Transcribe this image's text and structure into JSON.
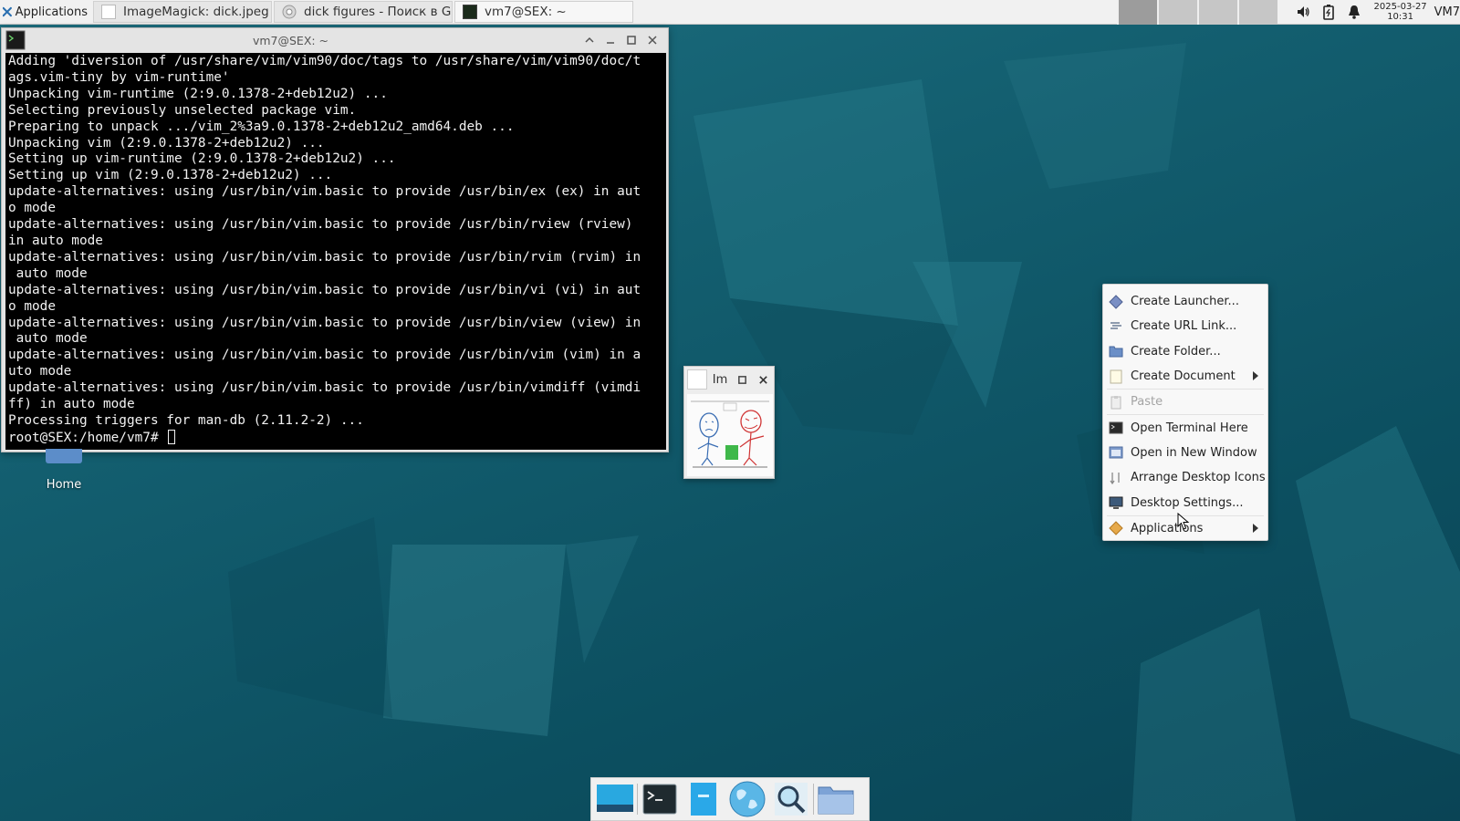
{
  "top_panel": {
    "applications_label": "Applications",
    "tasks": [
      {
        "label": "ImageMagick: dick.jpeg",
        "icon": "document-icon"
      },
      {
        "label": "dick figures - Поиск в Go...",
        "icon": "chrome-icon"
      },
      {
        "label": "vm7@SEX: ~",
        "icon": "terminal-icon"
      }
    ],
    "clock_date": "2025-03-27",
    "clock_time": "10:31",
    "user": "VM7"
  },
  "terminal": {
    "title": "vm7@SEX: ~",
    "lines": [
      "Adding 'diversion of /usr/share/vim/vim90/doc/tags to /usr/share/vim/vim90/doc/t",
      "ags.vim-tiny by vim-runtime'",
      "Unpacking vim-runtime (2:9.0.1378-2+deb12u2) ...",
      "Selecting previously unselected package vim.",
      "Preparing to unpack .../vim_2%3a9.0.1378-2+deb12u2_amd64.deb ...",
      "Unpacking vim (2:9.0.1378-2+deb12u2) ...",
      "Setting up vim-runtime (2:9.0.1378-2+deb12u2) ...",
      "Setting up vim (2:9.0.1378-2+deb12u2) ...",
      "update-alternatives: using /usr/bin/vim.basic to provide /usr/bin/ex (ex) in aut",
      "o mode",
      "update-alternatives: using /usr/bin/vim.basic to provide /usr/bin/rview (rview)",
      "in auto mode",
      "update-alternatives: using /usr/bin/vim.basic to provide /usr/bin/rvim (rvim) in",
      " auto mode",
      "update-alternatives: using /usr/bin/vim.basic to provide /usr/bin/vi (vi) in aut",
      "o mode",
      "update-alternatives: using /usr/bin/vim.basic to provide /usr/bin/view (view) in",
      " auto mode",
      "update-alternatives: using /usr/bin/vim.basic to provide /usr/bin/vim (vim) in a",
      "uto mode",
      "update-alternatives: using /usr/bin/vim.basic to provide /usr/bin/vimdiff (vimdi",
      "ff) in auto mode",
      "Processing triggers for man-db (2.11.2-2) ..."
    ],
    "prompt": "root@SEX:/home/vm7#"
  },
  "desktop": {
    "home_label": "Home"
  },
  "image_window": {
    "title": "Im"
  },
  "context_menu": {
    "items": [
      {
        "label": "Create Launcher...",
        "icon": "launcher-icon",
        "enabled": true
      },
      {
        "label": "Create URL Link...",
        "icon": "url-link-icon",
        "enabled": true
      },
      {
        "label": "Create Folder...",
        "icon": "folder-icon",
        "enabled": true
      },
      {
        "label": "Create Document",
        "icon": "document-icon",
        "enabled": true,
        "submenu": true
      },
      {
        "label": "Paste",
        "icon": "paste-icon",
        "enabled": false
      },
      {
        "label": "Open Terminal Here",
        "icon": "terminal-icon",
        "enabled": true
      },
      {
        "label": "Open in New Window",
        "icon": "window-icon",
        "enabled": true
      },
      {
        "label": "Arrange Desktop Icons",
        "icon": "arrange-icon",
        "enabled": true
      },
      {
        "label": "Desktop Settings...",
        "icon": "settings-icon",
        "enabled": true
      },
      {
        "label": "Applications",
        "icon": "applications-icon",
        "enabled": true,
        "submenu": true
      }
    ]
  },
  "dock": {
    "items": [
      "show-desktop-icon",
      "terminal-icon",
      "file-manager-icon",
      "web-browser-icon",
      "app-finder-icon",
      "folder-icon"
    ]
  }
}
